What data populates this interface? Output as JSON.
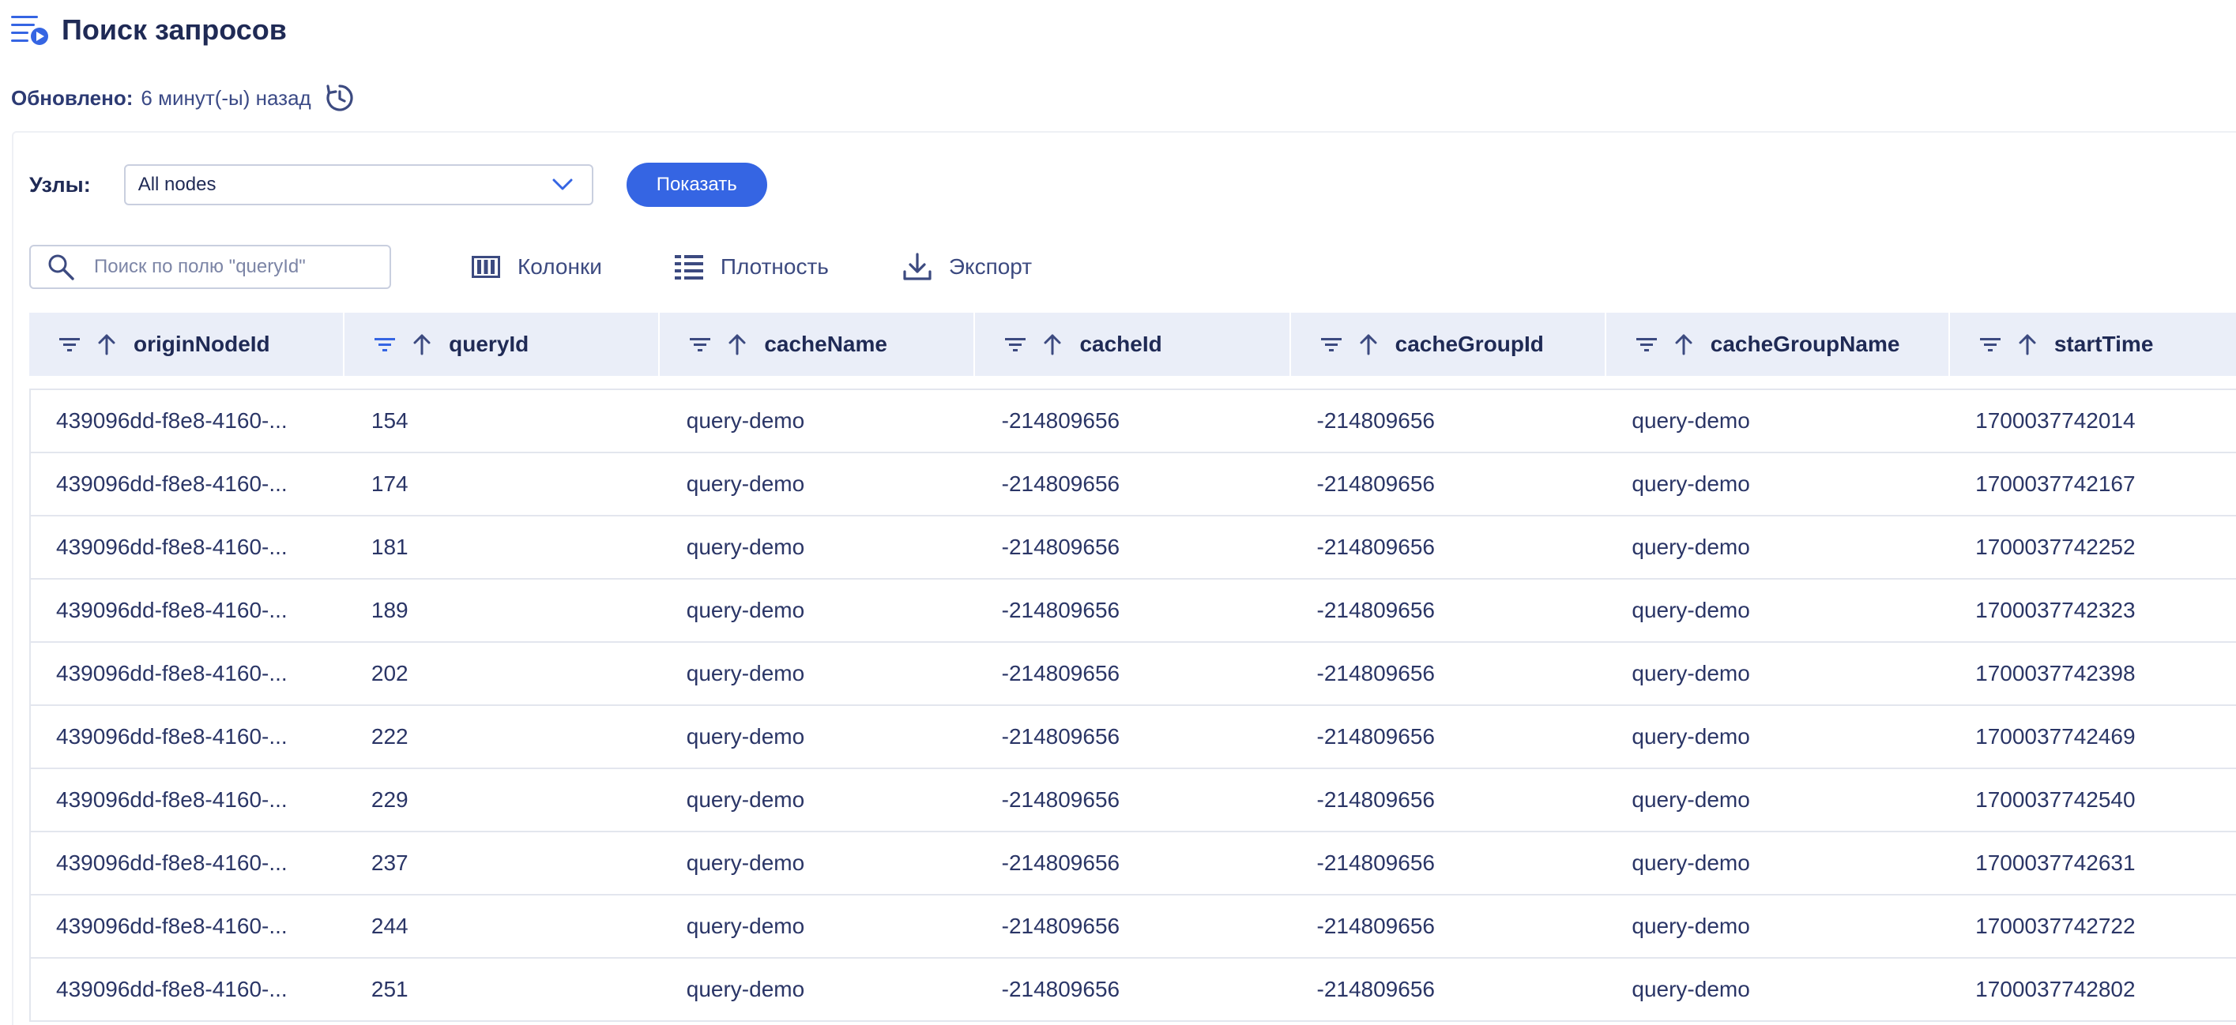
{
  "header": {
    "title": "Поиск запросов",
    "updated_label": "Обновлено:",
    "updated_value": "6 минут(-ы) назад"
  },
  "filters": {
    "nodes_label": "Узлы:",
    "nodes_selected": "All nodes",
    "show_button": "Показать"
  },
  "toolbar": {
    "search_placeholder": "Поиск по полю \"queryId\"",
    "columns_label": "Колонки",
    "density_label": "Плотность",
    "export_label": "Экспорт"
  },
  "colors": {
    "accent": "#3565e3",
    "header_bg": "#eaeef8",
    "text": "#1f2a55"
  },
  "table": {
    "columns": [
      "originNodeId",
      "queryId",
      "cacheName",
      "cacheId",
      "cacheGroupId",
      "cacheGroupName",
      "startTime"
    ],
    "rows": [
      [
        "439096dd-f8e8-4160-...",
        "154",
        "query-demo",
        "-214809656",
        "-214809656",
        "query-demo",
        "1700037742014"
      ],
      [
        "439096dd-f8e8-4160-...",
        "174",
        "query-demo",
        "-214809656",
        "-214809656",
        "query-demo",
        "1700037742167"
      ],
      [
        "439096dd-f8e8-4160-...",
        "181",
        "query-demo",
        "-214809656",
        "-214809656",
        "query-demo",
        "1700037742252"
      ],
      [
        "439096dd-f8e8-4160-...",
        "189",
        "query-demo",
        "-214809656",
        "-214809656",
        "query-demo",
        "1700037742323"
      ],
      [
        "439096dd-f8e8-4160-...",
        "202",
        "query-demo",
        "-214809656",
        "-214809656",
        "query-demo",
        "1700037742398"
      ],
      [
        "439096dd-f8e8-4160-...",
        "222",
        "query-demo",
        "-214809656",
        "-214809656",
        "query-demo",
        "1700037742469"
      ],
      [
        "439096dd-f8e8-4160-...",
        "229",
        "query-demo",
        "-214809656",
        "-214809656",
        "query-demo",
        "1700037742540"
      ],
      [
        "439096dd-f8e8-4160-...",
        "237",
        "query-demo",
        "-214809656",
        "-214809656",
        "query-demo",
        "1700037742631"
      ],
      [
        "439096dd-f8e8-4160-...",
        "244",
        "query-demo",
        "-214809656",
        "-214809656",
        "query-demo",
        "1700037742722"
      ],
      [
        "439096dd-f8e8-4160-...",
        "251",
        "query-demo",
        "-214809656",
        "-214809656",
        "query-demo",
        "1700037742802"
      ]
    ]
  }
}
